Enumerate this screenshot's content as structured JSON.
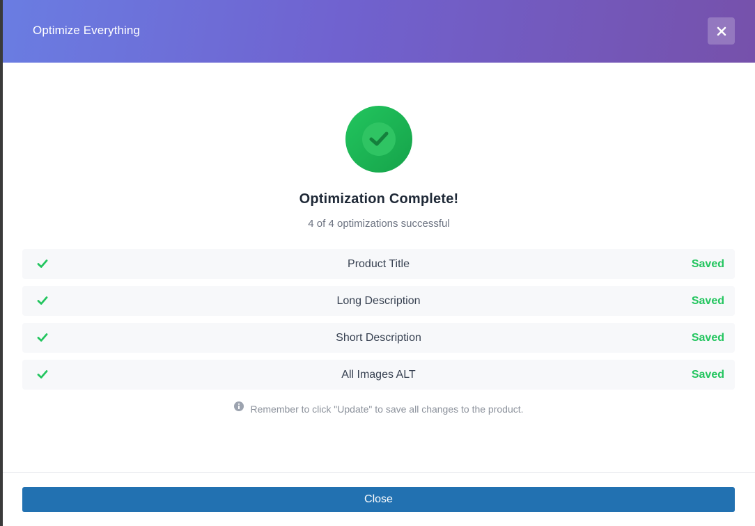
{
  "modal": {
    "title": "Optimize Everything"
  },
  "result": {
    "heading": "Optimization Complete!",
    "summary": "4 of 4 optimizations successful"
  },
  "items": [
    {
      "label": "Product Title",
      "status": "Saved"
    },
    {
      "label": "Long Description",
      "status": "Saved"
    },
    {
      "label": "Short Description",
      "status": "Saved"
    },
    {
      "label": "All Images ALT",
      "status": "Saved"
    }
  ],
  "note": {
    "text": "Remember to click \"Update\" to save all changes to the product."
  },
  "footer": {
    "close_label": "Close"
  },
  "colors": {
    "accent_success": "#22c55e",
    "primary_button": "#2271b1",
    "header_gradient_start": "#6a7de2",
    "header_gradient_end": "#7651ab"
  },
  "icons": {
    "close": "close-icon",
    "success": "check-circle-icon",
    "row": "check-icon",
    "note": "info-icon"
  }
}
